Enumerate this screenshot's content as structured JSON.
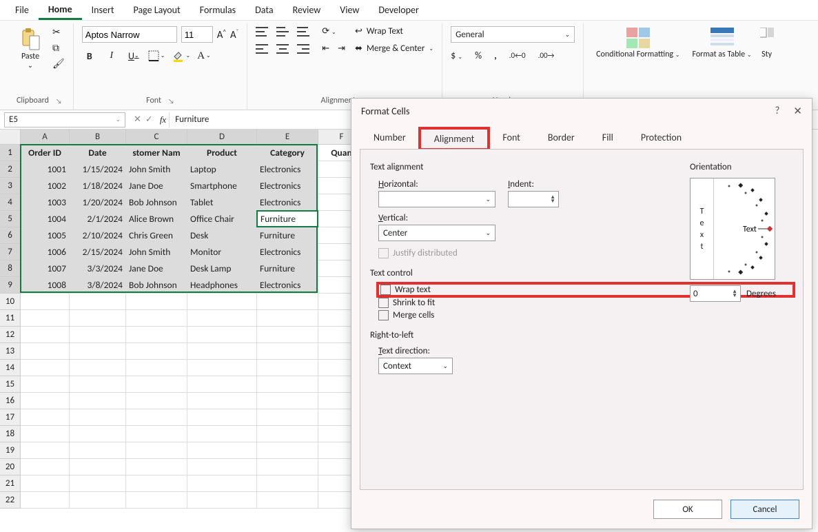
{
  "menu": {
    "items": [
      "File",
      "Home",
      "Insert",
      "Page Layout",
      "Formulas",
      "Data",
      "Review",
      "View",
      "Developer"
    ],
    "active": "Home"
  },
  "ribbon": {
    "clipboard": {
      "paste": "Paste",
      "label": "Clipboard"
    },
    "font": {
      "name": "Aptos Narrow",
      "size": "11",
      "label": "Font",
      "bold": "B",
      "italic": "I",
      "underline": "U"
    },
    "alignment": {
      "label": "Alignment",
      "wrap": "Wrap Text",
      "merge": "Merge & Center"
    },
    "number": {
      "format": "General",
      "label": "Number"
    },
    "styles": {
      "cond": "Conditional Formatting",
      "table": "Format as Table",
      "sty": "Sty"
    }
  },
  "namebox": "E5",
  "formula": "Furniture",
  "sheet": {
    "cols": [
      "A",
      "B",
      "C",
      "D",
      "E",
      "F"
    ],
    "colF": "Quan",
    "headers": [
      "Order ID",
      "Date",
      "stomer Nam",
      "Product",
      "Category"
    ],
    "rows": [
      {
        "id": "1001",
        "date": "1/15/2024",
        "name": "John Smith",
        "product": "Laptop",
        "cat": "Electronics"
      },
      {
        "id": "1002",
        "date": "1/18/2024",
        "name": "Jane Doe",
        "product": "Smartphone",
        "cat": "Electronics"
      },
      {
        "id": "1003",
        "date": "1/20/2024",
        "name": "Bob Johnson",
        "product": "Tablet",
        "cat": "Electronics"
      },
      {
        "id": "1004",
        "date": "2/1/2024",
        "name": "Alice Brown",
        "product": "Office Chair",
        "cat": "Furniture"
      },
      {
        "id": "1005",
        "date": "2/10/2024",
        "name": "Chris Green",
        "product": "Desk",
        "cat": "Furniture"
      },
      {
        "id": "1006",
        "date": "2/15/2024",
        "name": "John Smith",
        "product": "Monitor",
        "cat": "Electronics"
      },
      {
        "id": "1007",
        "date": "3/3/2024",
        "name": "Jane Doe",
        "product": "Desk Lamp",
        "cat": "Furniture"
      },
      {
        "id": "1008",
        "date": "3/8/2024",
        "name": "Bob Johnson",
        "product": "Headphones",
        "cat": "Electronics"
      }
    ],
    "active_value": "Furniture"
  },
  "dialog": {
    "title": "Format Cells",
    "tabs": [
      "Number",
      "Alignment",
      "Font",
      "Border",
      "Fill",
      "Protection"
    ],
    "active_tab": "Alignment",
    "groups": {
      "text_alignment": "Text alignment",
      "horizontal": "Horizontal:",
      "vertical": "Vertical:",
      "vertical_value": "Center",
      "indent": "Indent:",
      "justify": "Justify distributed",
      "text_control": "Text control",
      "wrap": "Wrap text",
      "shrink": "Shrink to fit",
      "merge": "Merge cells",
      "rtl": "Right-to-left",
      "textdir": "Text direction:",
      "textdir_value": "Context",
      "orientation": "Orientation",
      "orient_text": "Text",
      "degrees_value": "0",
      "degrees_label": "Degrees"
    },
    "buttons": {
      "ok": "OK",
      "cancel": "Cancel"
    }
  }
}
